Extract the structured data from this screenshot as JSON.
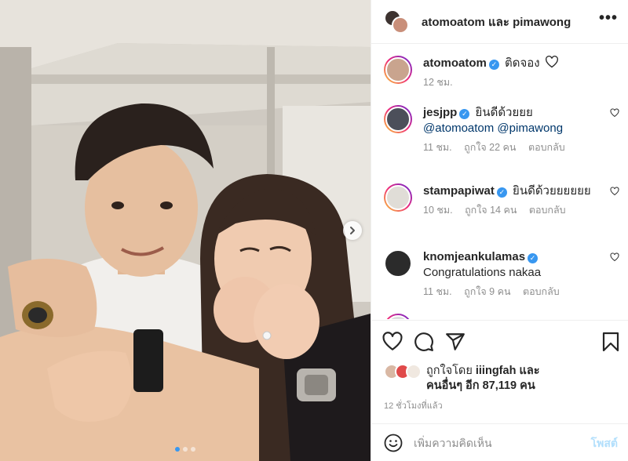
{
  "post": {
    "header_title": "atomoatom และ pimawong",
    "more_label": "•••"
  },
  "comments": [
    {
      "user": "atomoatom",
      "verified": true,
      "text": "ติดจอง",
      "time": "12 ชม."
    },
    {
      "user": "jesjpp",
      "verified": true,
      "text": "ยินดีด้วยยย",
      "mentions": "@atomoatom @pimawong",
      "time": "11 ชม.",
      "likes": "ถูกใจ 22 คน",
      "reply": "ตอบกลับ"
    },
    {
      "user": "stampapiwat",
      "verified": true,
      "text": "ยินดีด้วยยยยยย",
      "time": "10 ชม.",
      "likes": "ถูกใจ 14 คน",
      "reply": "ตอบกลับ"
    },
    {
      "user": "knomjeankulamas",
      "verified": true,
      "text": "Congratulations nakaa",
      "time": "11 ชม.",
      "likes": "ถูกใจ 9 คน",
      "reply": "ตอบกลับ"
    }
  ],
  "likes": {
    "prefix": "ถูกใจโดย",
    "first_liker": "iiingfah",
    "and": "และ",
    "others": "คนอื่นๆ อีก 87,119 คน"
  },
  "timestamp": "12 ชั่วโมงที่แล้ว",
  "composer": {
    "placeholder": "เพิ่มความคิดเห็น",
    "post_label": "โพสต์"
  },
  "carousel": {
    "current": 1,
    "total": 3
  },
  "colors": {
    "accent": "#3897f0",
    "post_disabled": "#b2dffc",
    "muted": "#8e8e8e"
  },
  "icons": [
    "chevron-right-icon",
    "heart-icon",
    "comment-icon",
    "share-icon",
    "bookmark-icon",
    "emoji-icon",
    "verified-icon",
    "more-icon"
  ]
}
